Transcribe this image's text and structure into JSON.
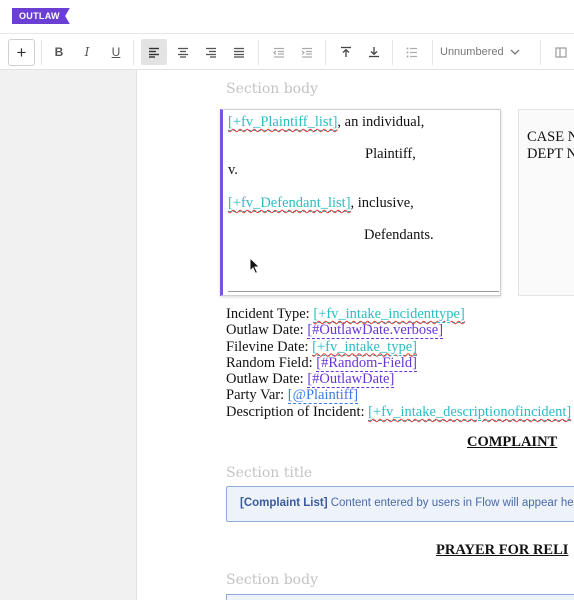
{
  "app": {
    "logo_text": "OUTLAW",
    "brand_color": "#6b3fd4"
  },
  "toolbar": {
    "add_label": "+",
    "bold_label": "B",
    "italic_label": "I",
    "underline_label": "U",
    "list_style_value": "Unnumbered"
  },
  "document": {
    "section_body_label": "Section body",
    "caption": {
      "plaintiff_merge": "[+fv_Plaintiff_list]",
      "plaintiff_suffix": ", an individual,",
      "plaintiff_role": "Plaintiff,",
      "versus": "v.",
      "defendant_merge": "[+fv_Defendant_list]",
      "defendant_suffix": ", inclusive,",
      "defendant_role": "Defendants.",
      "case_no_label": "CASE N",
      "dept_label": "DEPT N"
    },
    "fields": [
      {
        "label": "Incident Type: ",
        "value": "[+fv_intake_incidenttype]",
        "style": "teal"
      },
      {
        "label": "Outlaw Date: ",
        "value": "[#OutlawDate.verbose]",
        "style": "purple"
      },
      {
        "label": "Filevine Date: ",
        "value": "[+fv_intake_type]",
        "style": "teal"
      },
      {
        "label": "Random Field: ",
        "value": "[#Random-Field]",
        "style": "purple"
      },
      {
        "label": "Outlaw Date: ",
        "value": "[#OutlawDate]",
        "style": "purple"
      },
      {
        "label": "Party Var: ",
        "value": "[@Plaintiff]",
        "style": "blue"
      },
      {
        "label": "Description of Incident: ",
        "value": "[+fv_intake_descriptionofincident]",
        "style": "teal"
      }
    ],
    "complaint_heading": "COMPLAINT",
    "section_title_label": "Section title",
    "complaint_list_name": "[Complaint List]",
    "complaint_list_text": " Content entered by users in Flow will appear here.",
    "prayer_heading": "PRAYER FOR RELI",
    "section_body_label_2": "Section body"
  }
}
